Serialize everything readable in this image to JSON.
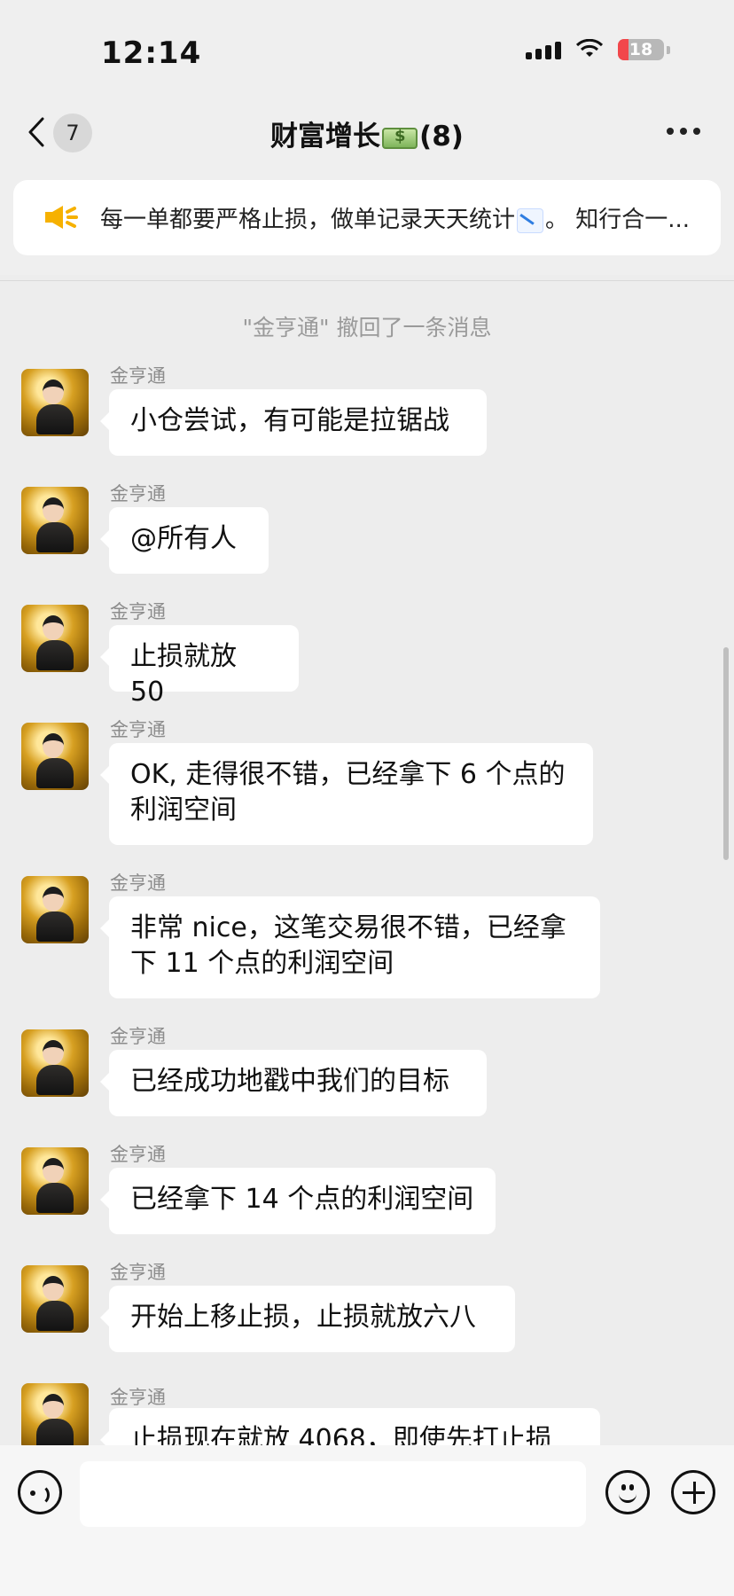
{
  "status_bar": {
    "time": "12:14",
    "battery": "18"
  },
  "header": {
    "unread_count": "7",
    "title_prefix": "财富增长",
    "title_suffix": "(8)"
  },
  "notice": {
    "text_before_icon": "每一单都要严格止损，做单记录天天统计",
    "text_after_icon": "。 知行合一..."
  },
  "chat": {
    "system_message": "\"金亨通\" 撤回了一条消息",
    "messages": [
      {
        "sender": "金亨通",
        "text": "小仓尝试，有可能是拉锯战"
      },
      {
        "sender": "金亨通",
        "text": "@所有人"
      },
      {
        "sender": "金亨通",
        "text": "止损就放 50"
      },
      {
        "sender": "金亨通",
        "text": "OK, 走得很不错，已经拿下 6 个点的\n利润空间"
      },
      {
        "sender": "金亨通",
        "text": "非常 nice，这笔交易很不错，已经拿\n下 11 个点的利润空间"
      },
      {
        "sender": "金亨通",
        "text": "已经成功地戳中我们的目标"
      },
      {
        "sender": "金亨通",
        "text": "已经拿下 14 个点的利润空间"
      },
      {
        "sender": "金亨通",
        "text": "开始上移止损，止损就放六八"
      },
      {
        "sender": "金亨通",
        "text": "止损现在就放 4068，即使先打止损"
      }
    ]
  },
  "composer": {
    "input_value": ""
  }
}
